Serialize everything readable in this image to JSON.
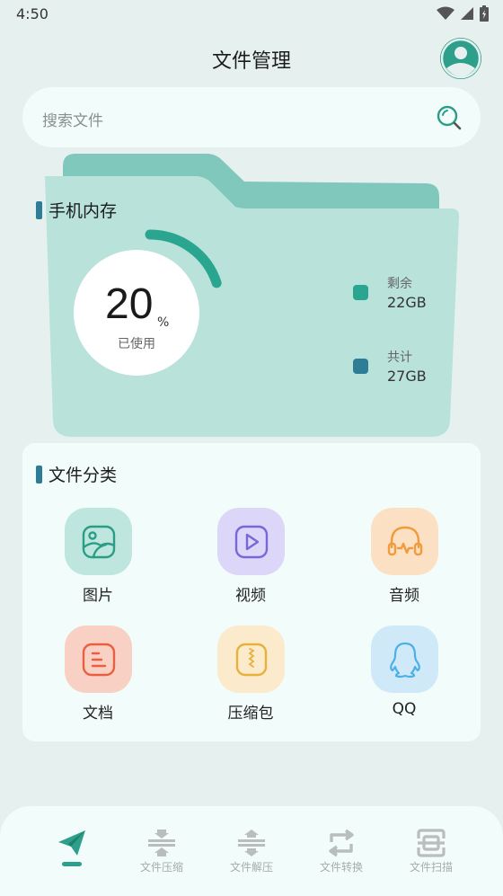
{
  "status": {
    "time": "4:50"
  },
  "header": {
    "title": "文件管理"
  },
  "search": {
    "placeholder": "搜索文件"
  },
  "storage": {
    "title": "手机内存",
    "used_percent": 20,
    "percent_text": "20",
    "unit": "%",
    "used_label": "已使用",
    "remaining_label": "剩余",
    "remaining_value": "22GB",
    "total_label": "共计",
    "total_value": "27GB",
    "colors": {
      "remaining": "#2aa690",
      "total": "#2e7d97",
      "ring": "#2aa690"
    }
  },
  "categories": {
    "title": "文件分类",
    "items": [
      {
        "label": "图片",
        "icon": "image-icon",
        "color": "#2a9d86",
        "bg": "#bfe6de"
      },
      {
        "label": "视频",
        "icon": "play-icon",
        "color": "#7a66d6",
        "bg": "#dcd6f8"
      },
      {
        "label": "音频",
        "icon": "headphones-icon",
        "color": "#f09b3c",
        "bg": "#fbe0c4"
      },
      {
        "label": "文档",
        "icon": "document-icon",
        "color": "#e86040",
        "bg": "#f9d0c4"
      },
      {
        "label": "压缩包",
        "icon": "zip-icon",
        "color": "#e7b23c",
        "bg": "#fbeacb"
      },
      {
        "label": "QQ",
        "icon": "qq-icon",
        "color": "#4cb0e8",
        "bg": "#cfe9f9"
      }
    ]
  },
  "nav": {
    "items": [
      {
        "label": "",
        "icon": "send-icon",
        "active": true
      },
      {
        "label": "文件压缩",
        "icon": "compress-icon"
      },
      {
        "label": "文件解压",
        "icon": "decompress-icon"
      },
      {
        "label": "文件转换",
        "icon": "convert-icon"
      },
      {
        "label": "文件扫描",
        "icon": "scan-icon"
      }
    ],
    "colors": {
      "active": "#2e9f8b",
      "inactive": "#b9bdbd"
    }
  }
}
